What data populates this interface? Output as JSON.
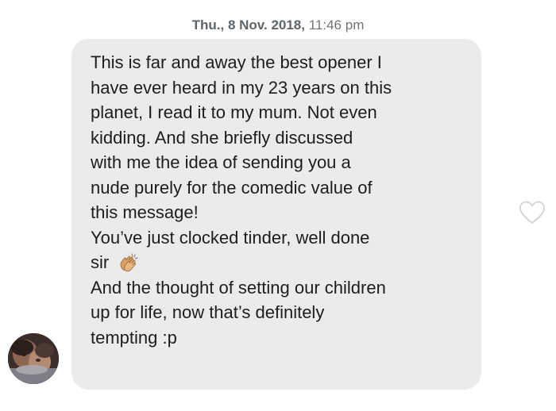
{
  "timestamp": {
    "day": "Thu.,",
    "date": "8 Nov. 2018,",
    "time": "11:46 pm"
  },
  "message": {
    "lines": [
      "This is far and away the best opener I",
      "have ever heard in my 23 years on this",
      "planet, I read it to my mum. Not even",
      "kidding. And she briefly discussed",
      "with me the idea of sending you a",
      "nude purely for the comedic value of",
      "this message!",
      "You’ve just clocked tinder, well done",
      "sir",
      "And the thought of setting our children",
      "up for life, now that’s definitely",
      "tempting :p"
    ],
    "emoji": "clapping-hands",
    "bubble_color": "#ebebed",
    "text_color": "#1d1d1f"
  },
  "icons": {
    "like": "heart-outline-icon",
    "sender": "avatar-photo"
  }
}
